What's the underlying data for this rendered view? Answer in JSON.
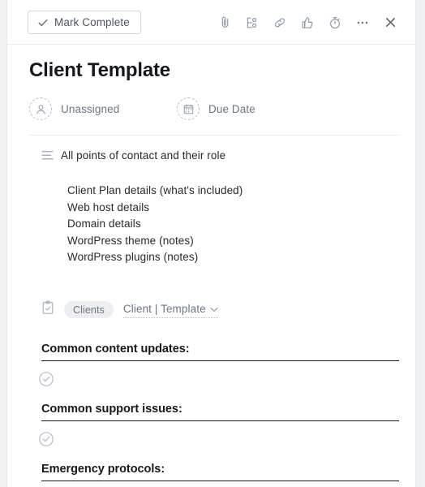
{
  "header": {
    "mark_complete_label": "Mark Complete",
    "mark_complete_icon": "check-icon",
    "actions": [
      {
        "name": "attachment-button",
        "icon": "paperclip-icon"
      },
      {
        "name": "subtask-button",
        "icon": "subtask-tree-icon"
      },
      {
        "name": "copy-link-button",
        "icon": "link-icon"
      },
      {
        "name": "like-button",
        "icon": "thumbs-up-icon"
      },
      {
        "name": "timer-button",
        "icon": "stopwatch-icon"
      },
      {
        "name": "more-options-button",
        "icon": "ellipsis-icon"
      },
      {
        "name": "close-button",
        "icon": "close-x-icon"
      }
    ]
  },
  "task": {
    "title": "Client Template",
    "assignee": {
      "label": "Unassigned",
      "icon": "person-icon"
    },
    "due_date": {
      "label": "Due Date",
      "icon": "calendar-icon"
    },
    "description": {
      "icon": "description-lines-icon",
      "heading": "All points of contact and their role",
      "lines": [
        "Client Plan details (what's included)",
        "Web host details",
        "Domain details",
        "WordPress theme (notes)",
        "WordPress plugins (notes)"
      ]
    },
    "project": {
      "icon": "clipboard-check-icon",
      "chip_label": "Clients",
      "section_label": "Client | Template",
      "section_caret_icon": "chevron-down-icon"
    },
    "subtasks": [
      {
        "type": "heading",
        "text": "Common content updates:"
      },
      {
        "type": "item",
        "text": "",
        "icon": "circle-check-icon"
      },
      {
        "type": "heading",
        "text": "Common support issues:"
      },
      {
        "type": "item",
        "text": "",
        "icon": "circle-check-icon"
      },
      {
        "type": "heading",
        "text": "Emergency protocols:"
      }
    ]
  },
  "colors": {
    "panel_background": "#ffffff",
    "page_background": "#f0f1f3",
    "text_primary": "#15181d",
    "text_secondary": "#6b7684",
    "icon_gray": "#8d98a8",
    "chip_background": "#eceef1",
    "divider": "#e8e9ed"
  }
}
